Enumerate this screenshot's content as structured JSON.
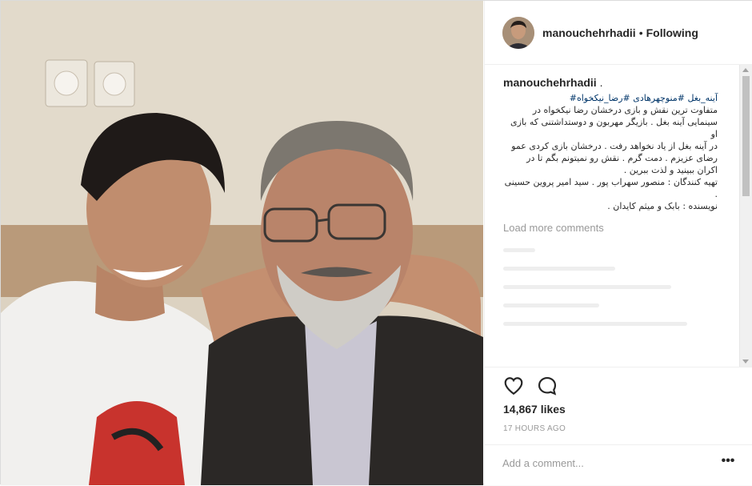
{
  "header": {
    "username": "manouchehrhadii",
    "separator": "•",
    "follow_status": "Following"
  },
  "caption": {
    "username": "manouchehrhadii",
    "suffix": " .",
    "hashtags": "آینه_بغل #منوچهرهادی #رضا_نیکخواه#",
    "lines": [
      "متفاوت ترین نقش و بازی درخشان رضا نیکخواه در",
      "سینمایی آینه بغل . بازیگر مهربون و دوستداشتنی که بازی او",
      "در آینه بغل از یاد نخواهد رفت . درخشان بازی کردی عمو",
      "رضای عزیزم . دمت گرم . نقش رو نمیتونم بگم تا در",
      "اکران ببینید و لذت ببرین .",
      "تهیه کنندگان : منصور سهراب پور . سید امیر پروین حسینی",
      ".",
      "نویسنده : بابک و میثم کایدان ."
    ]
  },
  "comments": {
    "load_more_label": "Load more comments"
  },
  "actions": {
    "like_icon": "heart-icon",
    "comment_icon": "speech-bubble-icon",
    "likes_label": "14,867 likes",
    "timestamp": "17 HOURS AGO"
  },
  "comment_box": {
    "placeholder": "Add a comment...",
    "more_label": "•••"
  },
  "colors": {
    "hashtag": "#003569",
    "muted": "#999999",
    "border": "#efefef",
    "text": "#262626"
  }
}
